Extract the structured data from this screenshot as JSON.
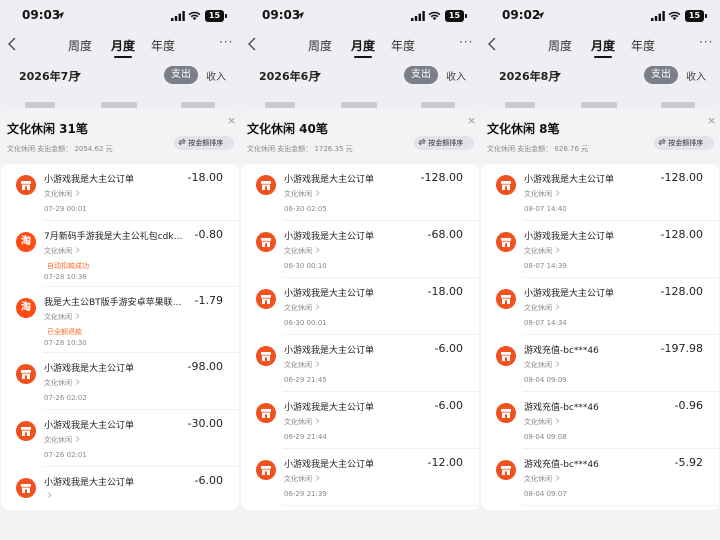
{
  "status_icons": [
    "location-arrow-icon",
    "signal-icon",
    "wifi-icon",
    "battery-icon"
  ],
  "nav_icons": [
    "back-chevron-icon",
    "more-icon"
  ],
  "row_icons": [
    "shop-icon",
    "taobao-icon"
  ],
  "accent_color": "#f0521f",
  "panels": [
    {
      "status": {
        "time": "09:03",
        "battery": "15"
      },
      "nav": {
        "back": "<",
        "tabs": [
          "周度",
          "月度",
          "年度"
        ],
        "active_tab": "月度",
        "more": "···"
      },
      "month": "2026年7月",
      "segment": {
        "expense": "支出",
        "income": "收入"
      },
      "sheet": {
        "title": "文化休闲 31笔",
        "summary": "文化休闲 支出金额： 2054.62 元",
        "sort_label": "按金额排序",
        "close": "×",
        "rows": [
          {
            "name": "小游戏我是大主公订单",
            "amount": "-18.00",
            "category": "文化休闲",
            "time": "07-29 00:01",
            "icon": "shop-icon"
          },
          {
            "name": "7月新码手游我是大主公礼包cdk…",
            "amount": "-0.80",
            "category": "文化休闲",
            "tag": "自动扣款成功",
            "time": "07-28 10:36",
            "icon": "taobao-icon",
            "icon_text": "淘"
          },
          {
            "name": "我是大主公BT版手游安卓苹果联…",
            "amount": "-1.79",
            "category": "文化休闲",
            "tag": "已全额退款",
            "time": "07-28 10:30",
            "icon": "taobao-icon",
            "icon_text": "淘"
          },
          {
            "name": "小游戏我是大主公订单",
            "amount": "-98.00",
            "category": "文化休闲",
            "time": "07-26 02:02",
            "icon": "shop-icon"
          },
          {
            "name": "小游戏我是大主公订单",
            "amount": "-30.00",
            "category": "文化休闲",
            "time": "07-26 02:01",
            "icon": "shop-icon"
          },
          {
            "name": "小游戏我是大主公订单",
            "amount": "-6.00",
            "category": "",
            "time": "",
            "icon": "shop-icon"
          }
        ]
      }
    },
    {
      "status": {
        "time": "09:03",
        "battery": "15"
      },
      "nav": {
        "back": "<",
        "tabs": [
          "周度",
          "月度",
          "年度"
        ],
        "active_tab": "月度",
        "more": "···"
      },
      "month": "2026年6月",
      "segment": {
        "expense": "支出",
        "income": "收入"
      },
      "sheet": {
        "title": "文化休闲 40笔",
        "summary": "文化休闲 支出金额： 1726.35 元",
        "sort_label": "按金额排序",
        "close": "×",
        "rows": [
          {
            "name": "小游戏我是大主公订单",
            "amount": "-128.00",
            "category": "文化休闲",
            "time": "06-30 02:05",
            "icon": "shop-icon"
          },
          {
            "name": "小游戏我是大主公订单",
            "amount": "-68.00",
            "category": "文化休闲",
            "time": "06-30 00:10",
            "icon": "shop-icon"
          },
          {
            "name": "小游戏我是大主公订单",
            "amount": "-18.00",
            "category": "文化休闲",
            "time": "06-30 00:01",
            "icon": "shop-icon"
          },
          {
            "name": "小游戏我是大主公订单",
            "amount": "-6.00",
            "category": "文化休闲",
            "time": "06-29 21:45",
            "icon": "shop-icon"
          },
          {
            "name": "小游戏我是大主公订单",
            "amount": "-6.00",
            "category": "文化休闲",
            "time": "06-29 21:44",
            "icon": "shop-icon"
          },
          {
            "name": "小游戏我是大主公订单",
            "amount": "-12.00",
            "category": "文化休闲",
            "time": "06-29 21:39",
            "icon": "shop-icon"
          }
        ]
      }
    },
    {
      "status": {
        "time": "09:02",
        "battery": "15"
      },
      "nav": {
        "back": "<",
        "tabs": [
          "周度",
          "月度",
          "年度"
        ],
        "active_tab": "月度",
        "more": "···"
      },
      "month": "2026年8月",
      "segment": {
        "expense": "支出",
        "income": "收入"
      },
      "sheet": {
        "title": "文化休闲 8笔",
        "summary": "文化休闲 支出金额： 626.76 元",
        "sort_label": "按金额排序",
        "close": "×",
        "rows": [
          {
            "name": "小游戏我是大主公订单",
            "amount": "-128.00",
            "category": "文化休闲",
            "time": "08-07 14:40",
            "icon": "shop-icon"
          },
          {
            "name": "小游戏我是大主公订单",
            "amount": "-128.00",
            "category": "文化休闲",
            "time": "08-07 14:39",
            "icon": "shop-icon"
          },
          {
            "name": "小游戏我是大主公订单",
            "amount": "-128.00",
            "category": "文化休闲",
            "time": "08-07 14:34",
            "icon": "shop-icon"
          },
          {
            "name": "游戏充值-bc***46",
            "amount": "-197.98",
            "category": "文化休闲",
            "time": "08-04 09:09",
            "icon": "shop-icon"
          },
          {
            "name": "游戏充值-bc***46",
            "amount": "-0.96",
            "category": "文化休闲",
            "time": "08-04 09:08",
            "icon": "shop-icon"
          },
          {
            "name": "游戏充值-bc***46",
            "amount": "-5.92",
            "category": "文化休闲",
            "time": "08-04 09:07",
            "icon": "shop-icon"
          }
        ]
      }
    }
  ]
}
